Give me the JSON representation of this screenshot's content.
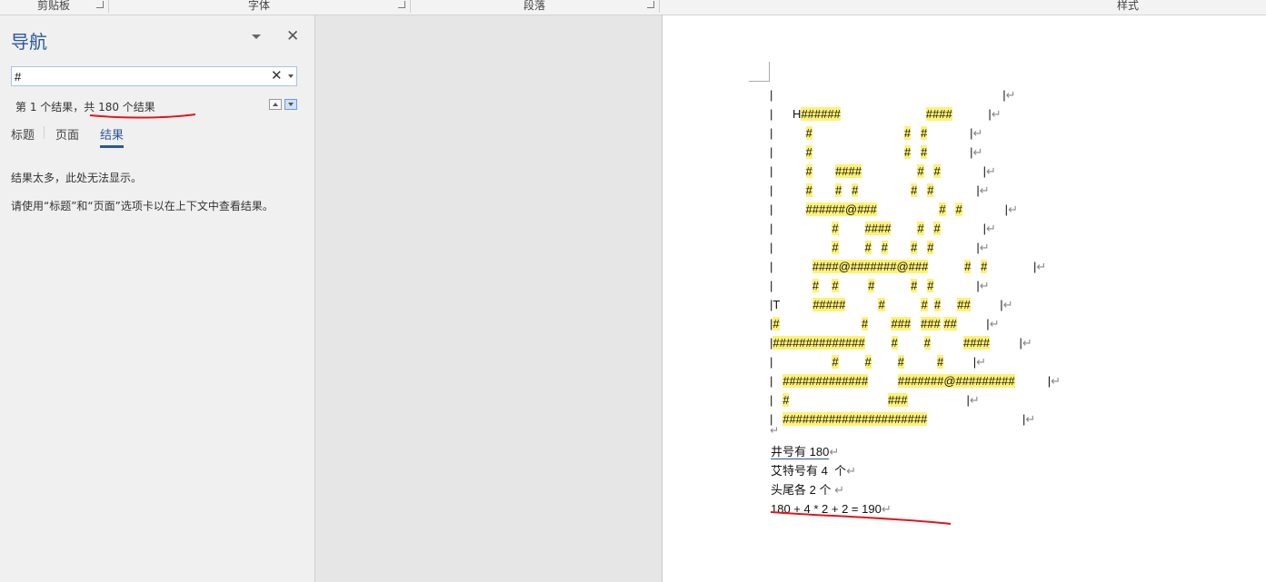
{
  "ribbon": {
    "groups": [
      {
        "label": "剪贴板"
      },
      {
        "label": "字体"
      },
      {
        "label": "段落"
      },
      {
        "label": "样式"
      }
    ]
  },
  "nav": {
    "title": "导航",
    "search_value": "#",
    "result_count": "第 1 个结果，共 180 个结果",
    "tabs": [
      "标题",
      "页面",
      "结果"
    ],
    "active_tab": "结果",
    "message1": "结果太多，此处无法显示。",
    "message2": "请使用“标题”和“页面”选项卡以在上下文中查看结果。"
  },
  "document": {
    "art_lines": [
      "|                                                                      |",
      "|      H######                          ####           |",
      "|          #                            #   #             |",
      "|          #                            #   #             |",
      "|          #       ####                 #   #             |",
      "|          #       #   #                #   #             |",
      "|          ######@###                   #   #             |",
      "|                  #        ####        #   #             |",
      "|                  #        #   #       #   #             |",
      "|            ####@#######@###           #   #              |",
      "|            #    #         #           #   #             |",
      "|T          #####          #           #  #     ##         |",
      "|#                         #       ###   ### ##         |",
      "|##############        #        #          ####         |",
      "|                  #        #        #          #         |",
      "|   #############         #######@#########          |",
      "|   #                              ###                  |",
      "|   ######################                             |"
    ],
    "summary_lines": [
      "井号有 180",
      "艾特号有 4  个",
      "头尾各 2 个 ",
      "180 + 4 * 2 + 2 = 190"
    ],
    "accent_color": "#2b579a",
    "highlight_color": "#fff176",
    "annotation_color": "#e0161b"
  }
}
